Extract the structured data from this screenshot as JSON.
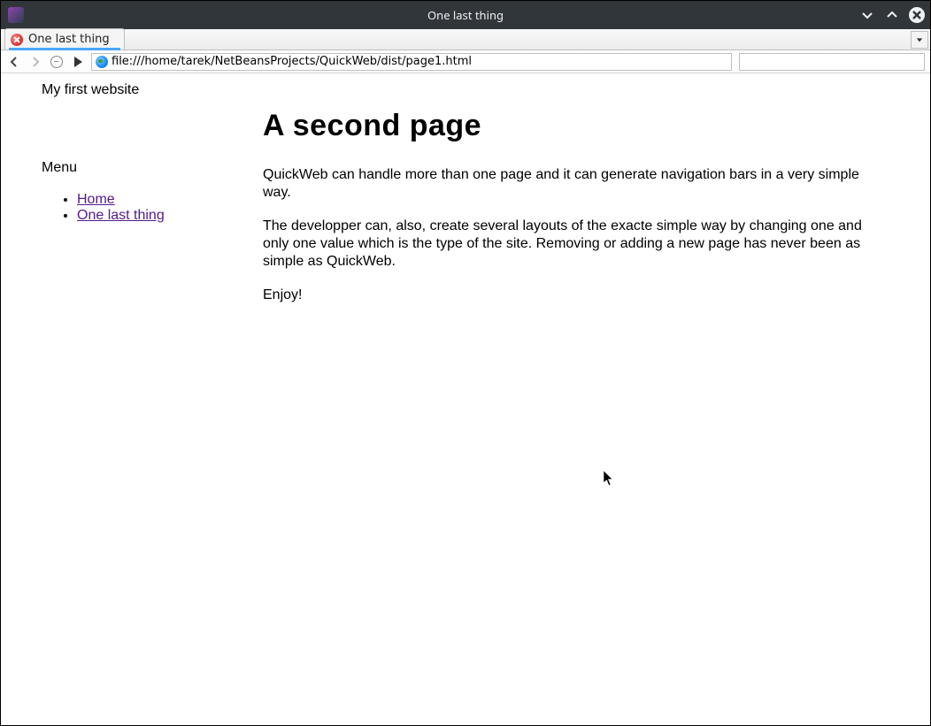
{
  "window": {
    "title": "One last thing"
  },
  "tab": {
    "label": "One last thing"
  },
  "url": "file:///home/tarek/NetBeansProjects/QuickWeb/dist/page1.html",
  "page": {
    "site_title": "My first website",
    "menu_heading": "Menu",
    "menu_items": [
      "Home",
      "One last thing"
    ],
    "heading": "A second page",
    "para1": "QuickWeb can handle more than one page and it can generate navigation bars in a very simple way.",
    "para2": "The developper can, also, create several layouts of the exacte simple way by changing one and only one value which is the type of the site. Removing or adding a new page has never been as simple as QuickWeb.",
    "para3": "Enjoy!"
  }
}
